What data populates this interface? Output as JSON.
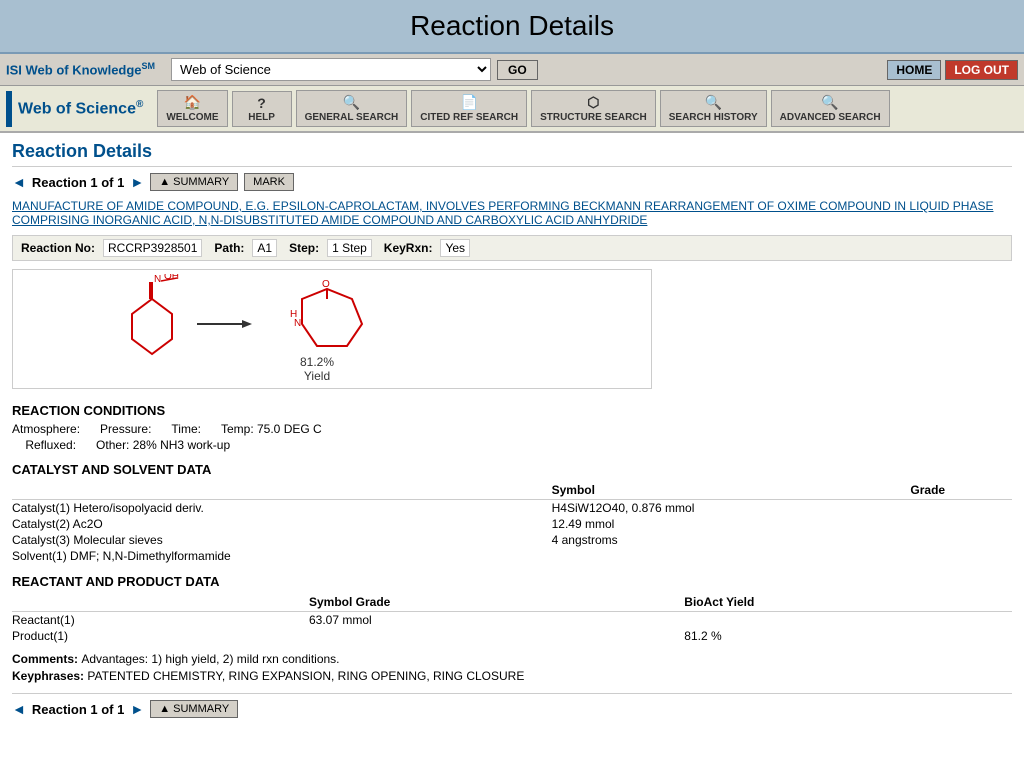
{
  "title_bar": {
    "text": "Reaction Details"
  },
  "top_nav": {
    "brand": "ISI Web of Knowledge",
    "brand_sup": "SM",
    "select_value": "Web of Science",
    "go_label": "GO",
    "home_label": "HOME",
    "logout_label": "LOG OUT"
  },
  "secondary_nav": {
    "brand_title": "Web of Science",
    "brand_reg": "®",
    "buttons": [
      {
        "icon": "🏠",
        "label": "WELCOME"
      },
      {
        "icon": "?",
        "label": "HELP"
      },
      {
        "icon": "🔍",
        "label": "GENERAL SEARCH"
      },
      {
        "icon": "📄",
        "label": "CITED REF SEARCH"
      },
      {
        "icon": "⬡",
        "label": "STRUCTURE SEARCH"
      },
      {
        "icon": "🔍",
        "label": "SEARCH HISTORY"
      },
      {
        "icon": "🔍",
        "label": "ADVANCED SEARCH"
      }
    ]
  },
  "page_title": "Reaction Details",
  "reaction_nav": {
    "prev_arrow": "◄",
    "label": "Reaction 1 of 1",
    "next_arrow": "►",
    "summary_label": "▲ SUMMARY",
    "mark_label": "MARK"
  },
  "reaction_title_link": "MANUFACTURE OF AMIDE COMPOUND, E.G. EPSILON-CAPROLACTAM, INVOLVES PERFORMING BECKMANN REARRANGEMENT OF OXIME COMPOUND IN LIQUID PHASE COMPRISING INORGANIC ACID, N,N-DISUBSTITUTED AMIDE COMPOUND AND CARBOXYLIC ACID ANHYDRIDE",
  "reaction_info": {
    "reaction_no_label": "Reaction No:",
    "reaction_no_value": "RCCRP3928501",
    "path_label": "Path:",
    "path_value": "A1",
    "step_label": "Step:",
    "step_value": "1 Step",
    "keyrxn_label": "KeyRxn:",
    "keyrxn_value": "Yes"
  },
  "diagram": {
    "yield_percent": "81.2%",
    "yield_label": "Yield"
  },
  "reaction_conditions": {
    "section_title": "REACTION CONDITIONS",
    "atmosphere_label": "Atmosphere:",
    "atmosphere_value": "",
    "pressure_label": "Pressure:",
    "pressure_value": "",
    "time_label": "Time:",
    "time_value": "",
    "temp_label": "Temp:",
    "temp_value": "75.0 DEG C",
    "refluxed_label": "Refluxed:",
    "refluxed_value": "",
    "other_label": "Other:",
    "other_value": "28% NH3 work-up"
  },
  "catalyst_section": {
    "section_title": "CATALYST AND SOLVENT DATA",
    "headers": [
      "Symbol",
      "Grade"
    ],
    "rows": [
      {
        "name": "Catalyst(1) Hetero/isopolyacid deriv.",
        "symbol": "H4SiW12O40, 0.876 mmol",
        "grade": ""
      },
      {
        "name": "Catalyst(2) Ac2O",
        "symbol": "12.49 mmol",
        "grade": ""
      },
      {
        "name": "Catalyst(3) Molecular sieves",
        "symbol": "4 angstroms",
        "grade": ""
      },
      {
        "name": "Solvent(1) DMF; N,N-Dimethylformamide",
        "symbol": "",
        "grade": ""
      }
    ]
  },
  "reactant_section": {
    "section_title": "REACTANT AND PRODUCT DATA",
    "headers": [
      "Symbol Grade",
      "BioAct Yield"
    ],
    "rows": [
      {
        "name": "Reactant(1)",
        "symbol_grade": "63.07 mmol",
        "bioact_yield": ""
      },
      {
        "name": "Product(1)",
        "symbol_grade": "",
        "bioact_yield": "81.2 %"
      }
    ]
  },
  "comments": {
    "comments_label": "Comments:",
    "comments_value": "Advantages: 1) high yield, 2) mild rxn conditions.",
    "keyphrases_label": "Keyphrases:",
    "keyphrases_value": "PATENTED CHEMISTRY, RING EXPANSION, RING OPENING, RING CLOSURE"
  }
}
